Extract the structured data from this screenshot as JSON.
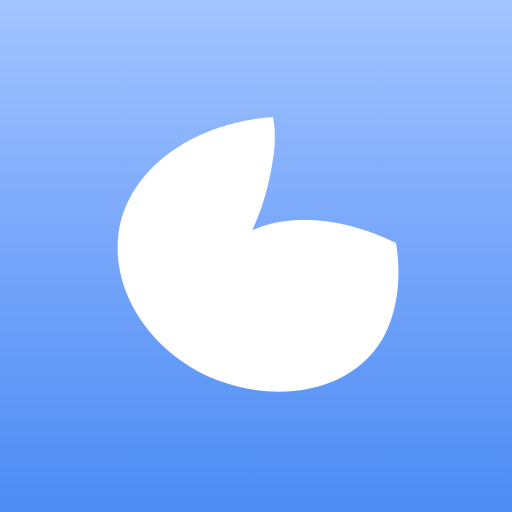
{
  "app_icon": {
    "icon": "sprouting-leaves-icon",
    "colors": {
      "background_top": "#a3c5ff",
      "background_middle": "#7aa8fb",
      "background_bottom": "#4c8cf4",
      "mark": "#ffffff"
    }
  }
}
